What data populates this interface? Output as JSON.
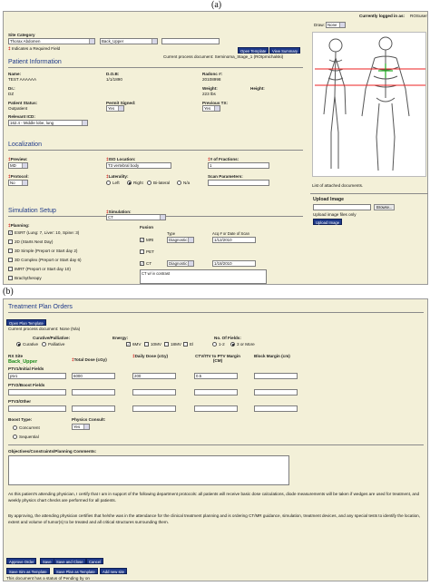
{
  "panel_a_label": "(a)",
  "panel_b_label": "(b)",
  "top": {
    "logged_in": "Currently logged in as:",
    "logged_in_user": "ROSuser",
    "draw_label": "Draw:",
    "draw_value": "None"
  },
  "site": {
    "category_label": "Site Category",
    "category_value": "Thorax Abdomen",
    "subsite_value": "Back_Upper",
    "required_note": "Indicates a Required Field",
    "open_template": "Open Template",
    "view_summary": "View Summary",
    "current_doc": "Current process document: Seminoma_Stage_1 (ROIpmichalski)"
  },
  "patient": {
    "section": "Patient Information",
    "name_label": "Name:",
    "name_value": "TEST AAAAAA",
    "dob_label": "D.O.B:",
    "dob_value": "1/1/1890",
    "radonc_label": "Radonc #:",
    "radonc_value": "20108998",
    "dr_label": "Dr.:",
    "dr_value": "DZ",
    "weight_label": "Weight:",
    "weight_value": "223 lbs",
    "height_label": "Height:",
    "height_value": "",
    "status_label": "Patient Status:",
    "status_value": "Outpatient",
    "permit_label": "Permit Signed:",
    "permit_value": "Yes",
    "prevtx_label": "Previous TX:",
    "prevtx_value": "Yes",
    "icd_label": "Relevant ICD:",
    "icd_value": "162.4 - Middle lobe, lung"
  },
  "body_diagram": {
    "attached": "List of attached documents.",
    "upload_title": "Upload Image",
    "browse": "Browse...",
    "upload_note": "Upload image files only",
    "upload_btn": "Upload Image"
  },
  "localization": {
    "section": "Localization",
    "preview_label": "Preview:",
    "preview_value": "MD",
    "iso_label": "ISO Location:",
    "iso_value": "T3 vertebral body",
    "fractions_label": "# of Fractions:",
    "fractions_value": "1",
    "protocol_label": "Protocol:",
    "protocol_value": "No",
    "laterality_label": "Laterality:",
    "lat_left": "Left",
    "lat_right": "Right",
    "lat_bilateral": "Bi-lateral",
    "lat_na": "N/a",
    "scan_label": "Scan Parameters:"
  },
  "simulation": {
    "section": "Simulation Setup",
    "sim_label": "Simulation:",
    "sim_value": "CT",
    "fusion_label": "Fusion",
    "planning_label": "Planning:",
    "type_header": "Type",
    "acq_header": "Acq # or Date of Scan",
    "plans": [
      {
        "label": "ESRT (Lung: 7, Liver: 10, Spine: 3)",
        "checked": true
      },
      {
        "label": "2D (Starts Next Day)",
        "checked": false
      },
      {
        "label": "3D Simple (Preport or Start day 2)",
        "checked": false
      },
      {
        "label": "3D Complex (Preport or Start day 6)",
        "checked": false
      },
      {
        "label": "IMRT (Preport or Start day 10)",
        "checked": false
      },
      {
        "label": "Brachytherapy",
        "checked": false
      }
    ],
    "fusion": [
      {
        "label": "MRI",
        "checked": true,
        "type": "Diagnostic",
        "date": "1/12/2010"
      },
      {
        "label": "PET",
        "checked": false,
        "type": "",
        "date": ""
      },
      {
        "label": "CT",
        "checked": true,
        "type": "Diagnostic",
        "date": "1/18/2010"
      }
    ],
    "notes": "CT w/ iv contrast"
  },
  "orders": {
    "section": "Treatment Plan Orders",
    "open_plan_template": "Open Plan Template",
    "current_doc": "Current process document: None (N/a)",
    "curative_label": "Curative/Palliative:",
    "curative": "Curative",
    "palliative": "Palliative",
    "energy_label": "Energy:",
    "energies": [
      "6MV",
      "10MV",
      "18MV",
      "El"
    ],
    "fields_label": "No. Of Fields:",
    "fields_opts": [
      "1-2",
      "3 or More"
    ],
    "rx_site_label": "RX Site",
    "rx_site_value": "Back_Upper",
    "total_dose": "Total Dose (cGy)",
    "daily_dose": "Daily Dose (cGy)",
    "ctv_margin": "CTV/ITV to PTV Margin (CM)",
    "block_margin": "Block Margin (cm)",
    "ptv1": "PTV1/Initial Fields",
    "ptv1_field": "ptv1",
    "ptv1_total": "6000",
    "ptv1_daily": "200",
    "ptv1_margin": "0.5",
    "ptv2": "PTV2/Boost Fields",
    "ptv3": "PTV3/Other",
    "boost_label": "Boost Type:",
    "concurrent": "Concurrent",
    "sequential": "Sequential",
    "physics_label": "Physics Consult:",
    "physics_value": "Yes",
    "objectives_label": "Objectives/Constraints/Planning Comments:",
    "para1": "As this patient's attending physician, I certify that I am in support of the following department protocols: all patients will receive basic dose calculations, diode measurements will be taken if wedges are used for treatment, and weekly physics chart checks are performed for all patients.",
    "para2": "By approving, the attending physician certifies that he/she was in the attendance for the clinical treatment planning and is ordering CT/MR guidance, simulation, treatment devices, and any special tests to identify the location, extent and volume of tumor(s) to be treated and all critical structures surrounding them.",
    "approve": "Approve Order",
    "save": "Save",
    "save_close": "Save and Close",
    "cancel": "Cancel",
    "save_sim_template": "Save Sim as Template",
    "save_plan_template": "Save Plan as Template",
    "add_site": "Add new site",
    "status_line": "This document has a status of Pending by on"
  }
}
